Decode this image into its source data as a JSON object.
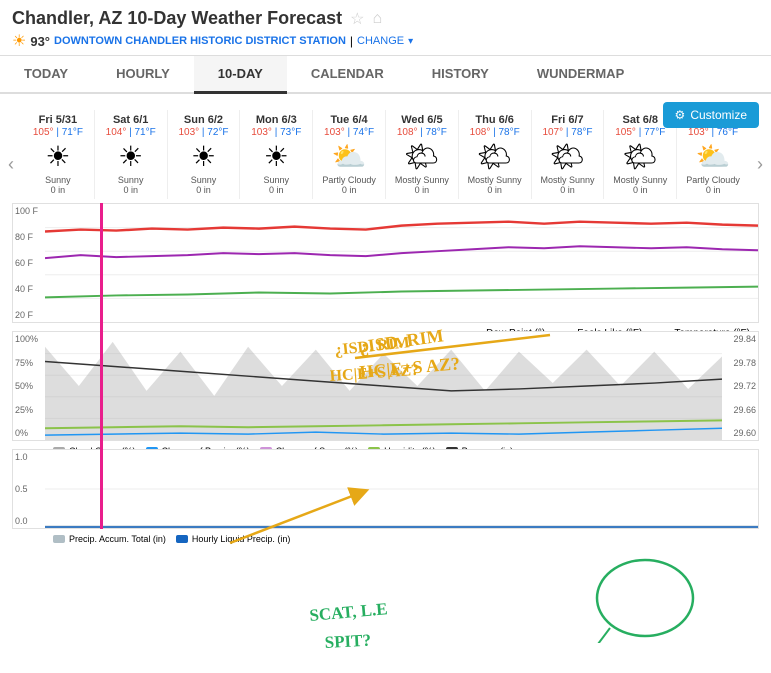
{
  "header": {
    "title": "Chandler, AZ 10-Day Weather Forecast",
    "temperature": "93°",
    "station": "DOWNTOWN CHANDLER HISTORIC DISTRICT STATION",
    "change_label": "CHANGE"
  },
  "nav": {
    "tabs": [
      "TODAY",
      "HOURLY",
      "10-DAY",
      "CALENDAR",
      "HISTORY",
      "WUNDERMAP"
    ],
    "active": "10-DAY"
  },
  "customize_label": "Customize",
  "days": [
    {
      "header": "Fri 5/31",
      "hi": "105°",
      "lo": "71°F",
      "icon": "☀",
      "desc": "Sunny",
      "precip": "0 in"
    },
    {
      "header": "Sat 6/1",
      "hi": "104°",
      "lo": "71°F",
      "icon": "☀",
      "desc": "Sunny",
      "precip": "0 in"
    },
    {
      "header": "Sun 6/2",
      "hi": "103°",
      "lo": "72°F",
      "icon": "☀",
      "desc": "Sunny",
      "precip": "0 in"
    },
    {
      "header": "Mon 6/3",
      "hi": "103°",
      "lo": "73°F",
      "icon": "☀",
      "desc": "Sunny",
      "precip": "0 in"
    },
    {
      "header": "Tue 6/4",
      "hi": "103°",
      "lo": "74°F",
      "icon": "⛅",
      "desc": "Partly Cloudy",
      "precip": "0 in"
    },
    {
      "header": "Wed 6/5",
      "hi": "108°",
      "lo": "78°F",
      "icon": "🌤",
      "desc": "Mostly Sunny",
      "precip": "0 in"
    },
    {
      "header": "Thu 6/6",
      "hi": "108°",
      "lo": "78°F",
      "icon": "🌤",
      "desc": "Mostly Sunny",
      "precip": "0 in"
    },
    {
      "header": "Fri 6/7",
      "hi": "107°",
      "lo": "78°F",
      "icon": "🌤",
      "desc": "Mostly Sunny",
      "precip": "0 in"
    },
    {
      "header": "Sat 6/8",
      "hi": "105°",
      "lo": "77°F",
      "icon": "🌤",
      "desc": "Mostly Sunny",
      "precip": "0 in"
    },
    {
      "header": "Sun 6/9",
      "hi": "103°",
      "lo": "76°F",
      "icon": "⛅",
      "desc": "Partly Cloudy",
      "precip": "0 in"
    }
  ],
  "temp_chart": {
    "y_labels": [
      "100 F",
      "80 F",
      "60 F",
      "40 F",
      "20 F"
    ]
  },
  "temp_legend": [
    {
      "label": "Dew Point (°)",
      "color": "#4caf50"
    },
    {
      "label": "Feels Like (°F)",
      "color": "#9c27b0"
    },
    {
      "label": "Temperature (°F)",
      "color": "#e53935"
    }
  ],
  "precip_chart": {
    "y_labels": [
      "100%",
      "75%",
      "50%",
      "25%",
      "0%"
    ]
  },
  "precip_legend": [
    {
      "label": "Cloud Cover (%)",
      "color": "#aaa"
    },
    {
      "label": "Chance of Precip. (%)",
      "color": "#2196f3"
    },
    {
      "label": "Chance of Snow (%)",
      "color": "#ce93d8"
    },
    {
      "label": "Humidity (%)",
      "color": "#8bc34a"
    },
    {
      "label": "Pressure (in)",
      "color": "#333"
    }
  ],
  "accum_chart": {
    "y_labels": [
      "1.0",
      "0.5",
      "0.0"
    ]
  },
  "accum_legend": [
    {
      "label": "Precip. Accum. Total (in)",
      "color": "#b0bec5"
    },
    {
      "label": "Hourly Liquid Precip. (in)",
      "color": "#1565c0"
    }
  ],
  "pressure_values": [
    "29.84",
    "29.78",
    "29.72",
    "29.66",
    "29.60"
  ]
}
